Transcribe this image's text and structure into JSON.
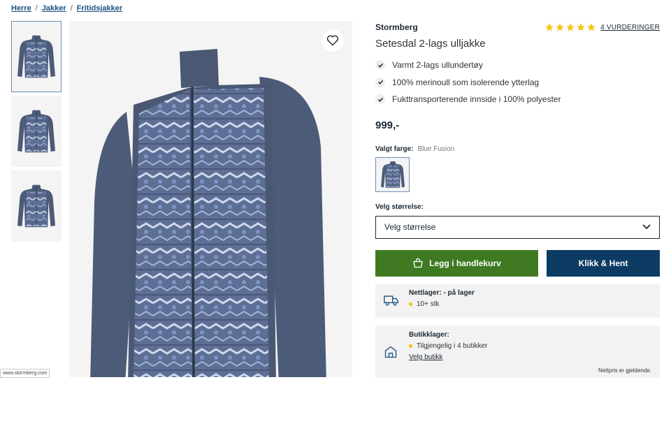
{
  "breadcrumb": [
    "Herre",
    "Jakker",
    "Fritidsjakker"
  ],
  "breadcrumb_separator": "/",
  "product": {
    "brand": "Stormberg",
    "rating": 5,
    "reviews_label": "4 VURDERINGER",
    "title": "Setesdal 2-lags ulljakke",
    "features": [
      "Varmt 2-lags ullundertøy",
      "100% merinoull som isolerende ytterlag",
      "Fukttransporterende innside i 100% polyester"
    ],
    "price": "999,-"
  },
  "color": {
    "label": "Valgt farge:",
    "value": "Blue Fusion"
  },
  "size": {
    "label": "Velg størrelse:",
    "placeholder": "Velg størrelse"
  },
  "buttons": {
    "cart": "Legg i handlekurv",
    "click_collect": "Klikk & Hent"
  },
  "online_stock": {
    "title": "Nettlager: - på lager",
    "status": "10+ stk"
  },
  "store_stock": {
    "title": "Butikklager:",
    "status": "Tilgjengelig i 4 butikker",
    "link": "Velg butikk",
    "note": "Nettpris er gjeldende."
  },
  "watermark": "www.stormberg.com",
  "colors": {
    "accent_green": "#3f7a22",
    "accent_navy": "#0c3b63",
    "link": "#1d4f80",
    "star": "#f5c518",
    "stock_dot": "#f2c500"
  },
  "icons": [
    "heart-icon",
    "check-icon",
    "star-icon",
    "chevron-down-icon",
    "basket-icon",
    "truck-icon",
    "store-icon"
  ]
}
